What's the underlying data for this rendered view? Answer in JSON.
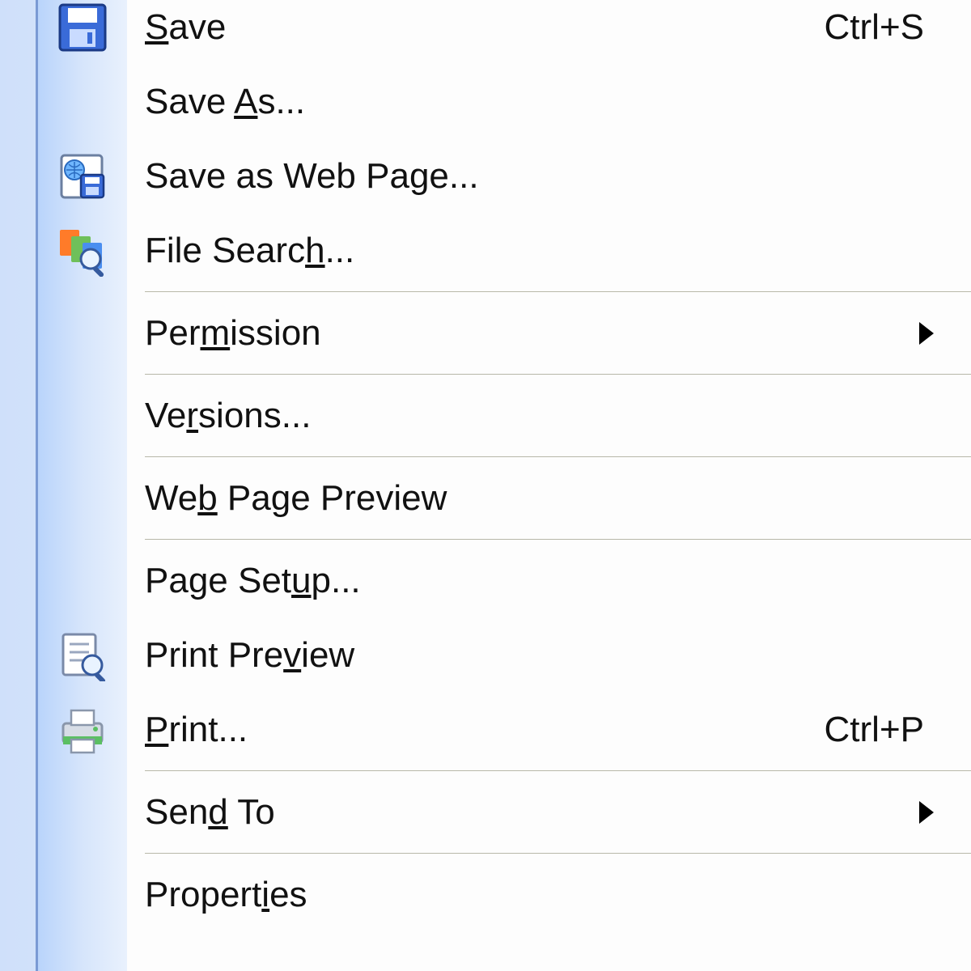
{
  "menu": {
    "items": [
      {
        "id": "save",
        "pre": "",
        "u": "S",
        "post": "ave",
        "shortcut": "Ctrl+S",
        "arrow": false,
        "icon": "save-icon",
        "sep_after": false
      },
      {
        "id": "save-as",
        "pre": "Save ",
        "u": "A",
        "post": "s...",
        "shortcut": "",
        "arrow": false,
        "icon": "",
        "sep_after": false
      },
      {
        "id": "save-as-web",
        "pre": "Save as Web Pa",
        "u": "g",
        "post": "e...",
        "shortcut": "",
        "arrow": false,
        "icon": "web-save-icon",
        "sep_after": false
      },
      {
        "id": "file-search",
        "pre": "File Searc",
        "u": "h",
        "post": "...",
        "shortcut": "",
        "arrow": false,
        "icon": "file-search-icon",
        "sep_after": true
      },
      {
        "id": "permission",
        "pre": "Per",
        "u": "m",
        "post": "ission",
        "shortcut": "",
        "arrow": true,
        "icon": "",
        "sep_after": true
      },
      {
        "id": "versions",
        "pre": "Ve",
        "u": "r",
        "post": "sions...",
        "shortcut": "",
        "arrow": false,
        "icon": "",
        "sep_after": true
      },
      {
        "id": "web-preview",
        "pre": "We",
        "u": "b",
        "post": " Page Preview",
        "shortcut": "",
        "arrow": false,
        "icon": "",
        "sep_after": true
      },
      {
        "id": "page-setup",
        "pre": "Page Set",
        "u": "u",
        "post": "p...",
        "shortcut": "",
        "arrow": false,
        "icon": "",
        "sep_after": false
      },
      {
        "id": "print-preview",
        "pre": "Print Pre",
        "u": "v",
        "post": "iew",
        "shortcut": "",
        "arrow": false,
        "icon": "print-preview-icon",
        "sep_after": false
      },
      {
        "id": "print",
        "pre": "",
        "u": "P",
        "post": "rint...",
        "shortcut": "Ctrl+P",
        "arrow": false,
        "icon": "print-icon",
        "sep_after": true
      },
      {
        "id": "send-to",
        "pre": "Sen",
        "u": "d",
        "post": " To",
        "shortcut": "",
        "arrow": true,
        "icon": "",
        "sep_after": true
      },
      {
        "id": "properties",
        "pre": "Propert",
        "u": "i",
        "post": "es",
        "shortcut": "",
        "arrow": false,
        "icon": "",
        "sep_after": false
      }
    ]
  }
}
